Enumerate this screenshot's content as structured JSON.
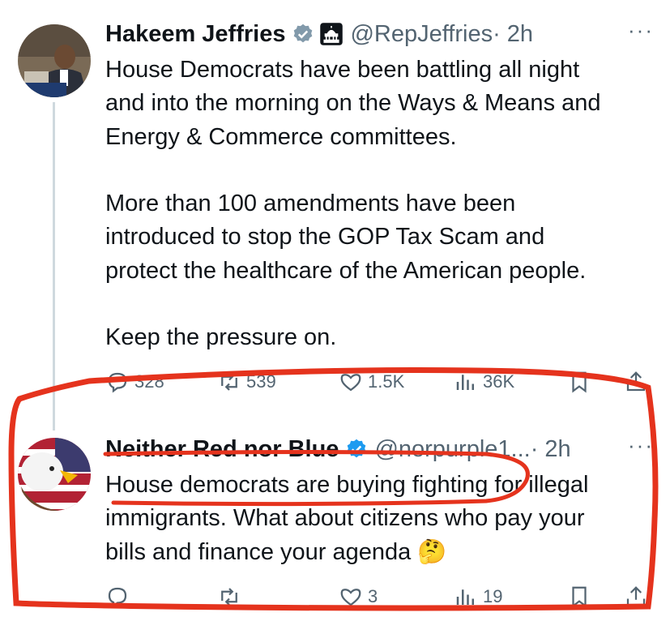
{
  "tweets": [
    {
      "author_name": "Hakeem Jeffries",
      "handle": "@RepJeffries",
      "time": "· 2h",
      "more": "···",
      "text": "House Democrats have been battling all night\nand into the morning on the Ways & Means and\nEnergy & Commerce committees.\n\nMore than 100 amendments have been\nintroduced to stop the GOP Tax Scam and\nprotect the healthcare of the American people.\n\nKeep the pressure on.",
      "replies": "328",
      "reposts": "539",
      "likes": "1.5K",
      "views": "36K",
      "avatar_icon": "photo-avatar"
    },
    {
      "author_name": "Neither Red nor Blue",
      "handle": "@norpurple1...",
      "time": "· 2h",
      "more": "···",
      "text": "House democrats are buying fighting for illegal\nimmigrants. What about citizens who pay your\nbills and finance your agenda 🤔",
      "replies": "",
      "reposts": "",
      "likes": "3",
      "views": "19",
      "avatar_icon": "eagle-flag-avatar"
    }
  ],
  "colors": {
    "text": "#0f1419",
    "secondary": "#536471",
    "verified": "#1d9bf0",
    "annotation": "#e5331d",
    "thread_line": "#cfd9de"
  }
}
